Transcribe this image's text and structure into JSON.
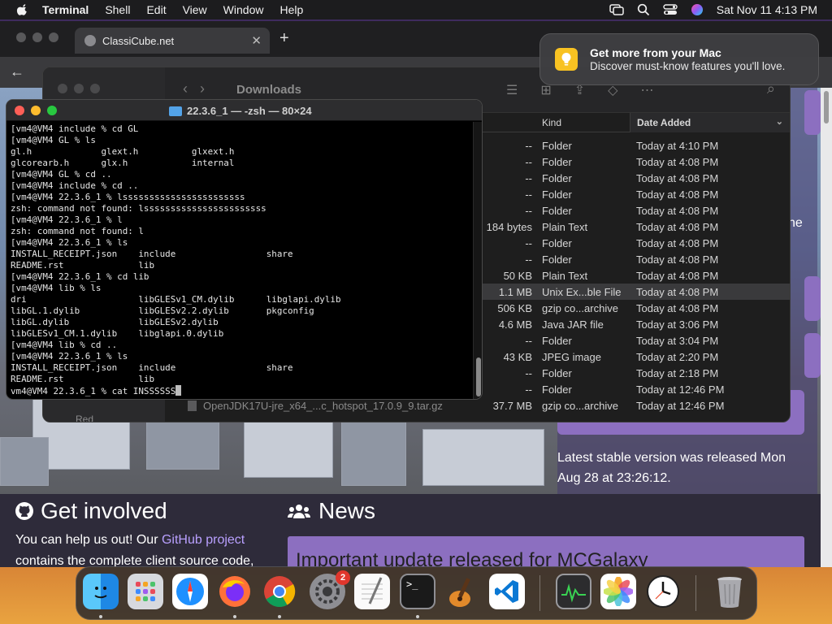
{
  "menubar": {
    "app_name": "Terminal",
    "items": [
      "Shell",
      "Edit",
      "View",
      "Window",
      "Help"
    ],
    "clock": "Sat Nov 11  4:13 PM"
  },
  "browser": {
    "tab_title": "ClassiCube.net",
    "tab_close": "✕",
    "new_tab": "+",
    "back_arrow": "←",
    "address_partial": "Cl"
  },
  "webpage": {
    "release_text": "Latest stable version was released Mon Aug 28 at 23:26:12.",
    "side_text": "ne",
    "get_involved_title": "Get involved",
    "news_title": "News",
    "involved_text_before": "You can help us out! Our ",
    "involved_link": "GitHub project",
    "involved_text_after": " contains the complete client source code,",
    "news_headline": "Important update released for MCGalaxy"
  },
  "notification": {
    "title": "Get more from your Mac",
    "body": "Discover must-know features you'll love."
  },
  "finder": {
    "title": "Downloads",
    "column_kind": "Kind",
    "column_date": "Date Added",
    "sidebar_partial": "Red",
    "rows": [
      {
        "name": "",
        "size": "--",
        "kind": "Folder",
        "date": "Today at 4:10 PM"
      },
      {
        "name": "",
        "size": "--",
        "kind": "Folder",
        "date": "Today at 4:08 PM"
      },
      {
        "name": "",
        "size": "--",
        "kind": "Folder",
        "date": "Today at 4:08 PM"
      },
      {
        "name": "",
        "size": "--",
        "kind": "Folder",
        "date": "Today at 4:08 PM"
      },
      {
        "name": "",
        "size": "--",
        "kind": "Folder",
        "date": "Today at 4:08 PM"
      },
      {
        "name": "",
        "size": "184 bytes",
        "kind": "Plain Text",
        "date": "Today at 4:08 PM"
      },
      {
        "name": "",
        "size": "--",
        "kind": "Folder",
        "date": "Today at 4:08 PM"
      },
      {
        "name": "",
        "size": "--",
        "kind": "Folder",
        "date": "Today at 4:08 PM"
      },
      {
        "name": "",
        "size": "50 KB",
        "kind": "Plain Text",
        "date": "Today at 4:08 PM"
      },
      {
        "name": "",
        "size": "1.1 MB",
        "kind": "Unix Ex...ble File",
        "date": "Today at 4:08 PM"
      },
      {
        "name": "",
        "size": "506 KB",
        "kind": "gzip co...archive",
        "date": "Today at 4:08 PM"
      },
      {
        "name": "",
        "size": "4.6 MB",
        "kind": "Java JAR file",
        "date": "Today at 3:06 PM"
      },
      {
        "name": "",
        "size": "--",
        "kind": "Folder",
        "date": "Today at 3:04 PM"
      },
      {
        "name": "",
        "size": "43 KB",
        "kind": "JPEG image",
        "date": "Today at 2:20 PM"
      },
      {
        "name": "",
        "size": "--",
        "kind": "Folder",
        "date": "Today at 2:18 PM"
      },
      {
        "name": "",
        "size": "--",
        "kind": "Folder",
        "date": "Today at 12:46 PM"
      },
      {
        "name": "OpenJDK17U-jre_x64_...c_hotspot_17.0.9_9.tar.gz",
        "size": "37.7 MB",
        "kind": "gzip co...archive",
        "date": "Today at 12:46 PM"
      }
    ]
  },
  "terminal": {
    "title": "22.3.6_1 — -zsh — 80×24",
    "lines": [
      "[vm4@VM4 include % cd GL",
      "[vm4@VM4 GL % ls",
      "gl.h             glext.h          glxext.h",
      "glcorearb.h      glx.h            internal",
      "[vm4@VM4 GL % cd ..",
      "[vm4@VM4 include % cd ..",
      "[vm4@VM4 22.3.6_1 % lsssssssssssssssssssssss",
      "zsh: command not found: lsssssssssssssssssssssss",
      "[vm4@VM4 22.3.6_1 % l",
      "zsh: command not found: l",
      "[vm4@VM4 22.3.6_1 % ls",
      "INSTALL_RECEIPT.json    include                 share",
      "README.rst              lib",
      "[vm4@VM4 22.3.6_1 % cd lib",
      "[vm4@VM4 lib % ls",
      "dri                     libGLESv1_CM.dylib      libglapi.dylib",
      "libGL.1.dylib           libGLESv2.2.dylib       pkgconfig",
      "libGL.dylib             libGLESv2.dylib",
      "libGLESv1_CM.1.dylib    libglapi.0.dylib",
      "[vm4@VM4 lib % cd ..",
      "[vm4@VM4 22.3.6_1 % ls",
      "INSTALL_RECEIPT.json    include                 share",
      "README.rst              lib",
      "vm4@VM4 22.3.6_1 % cat INSSSSSS"
    ]
  },
  "dock": {
    "items": [
      {
        "name": "finder",
        "running": true
      },
      {
        "name": "launchpad",
        "running": false
      },
      {
        "name": "safari",
        "running": false
      },
      {
        "name": "firefox",
        "running": true
      },
      {
        "name": "chrome",
        "running": true
      },
      {
        "name": "system-settings",
        "running": false,
        "badge": "2"
      },
      {
        "name": "textedit",
        "running": false
      },
      {
        "name": "terminal",
        "running": true
      },
      {
        "name": "garageband",
        "running": false
      },
      {
        "name": "vscode",
        "running": false
      },
      {
        "name": "activity-monitor",
        "running": false
      },
      {
        "name": "photos",
        "running": false
      },
      {
        "name": "clock",
        "running": false
      },
      {
        "name": "trash",
        "running": false
      }
    ]
  }
}
